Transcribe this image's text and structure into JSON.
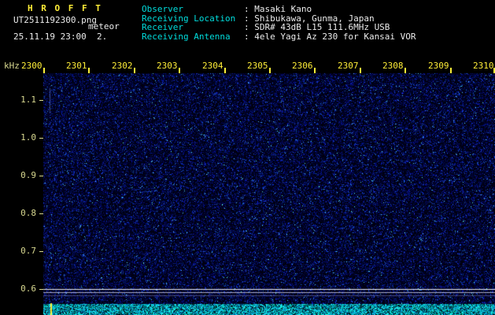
{
  "header": {
    "app_title": "H R O F F T",
    "filename": "UT2511192300.png",
    "tag": "meteor",
    "datetime": "25.11.19 23:00  2.",
    "info": [
      {
        "label": "Observer",
        "value": ": Masaki Kano"
      },
      {
        "label": "Receiving Location",
        "value": ": Shibukawa, Gunma, Japan"
      },
      {
        "label": "Receiver",
        "value": ": SDR# 43dB L15 111.6MHz USB"
      },
      {
        "label": "Receiving Antenna",
        "value": ": 4ele Yagi Az 230 for Kansai VOR"
      }
    ]
  },
  "chart_data": {
    "type": "heatmap",
    "title": "HROFFT radio meteor spectrogram, 10-minute frame starting 2025-11-19 23:00 UT",
    "x_axis": {
      "unit": "time UT (hhmm)",
      "ticks": [
        "2300",
        "2301",
        "2302",
        "2303",
        "2304",
        "2305",
        "2306",
        "2307",
        "2308",
        "2309",
        "2310"
      ]
    },
    "y_axis": {
      "label": "kHz",
      "ticks": [
        "1.1",
        "1.0",
        "0.9",
        "0.8",
        "0.7",
        "0.6"
      ],
      "range_khz": [
        0.57,
        1.17
      ]
    },
    "legend": "none",
    "grid": false,
    "carrier_lines_khz": [
      0.6,
      0.592,
      0.583
    ],
    "data_summary": "Uniform dark-blue background noise across the whole 10-minute frame with no meteor echo streaks. Two or three continuous narrow horizontal carrier lines near 0.58-0.60 kHz spanning full width. Bottom strip is the cyan signal-level trace at a steady low level. Faint vertical noise streak near 23:00 around 1.05-1.12 kHz. Yellow minute marker at the left edge of the level strip.",
    "colors": {
      "background": "#000000",
      "noise_speckle": "#1030b0",
      "sparkle": "#50c8ff",
      "x_tick_labels": "#ffee38",
      "y_tick_labels": "#d8d890",
      "carrier_line": "#ffffff",
      "level_strip": "#00dcdc",
      "minute_marker": "#ffee38"
    }
  }
}
